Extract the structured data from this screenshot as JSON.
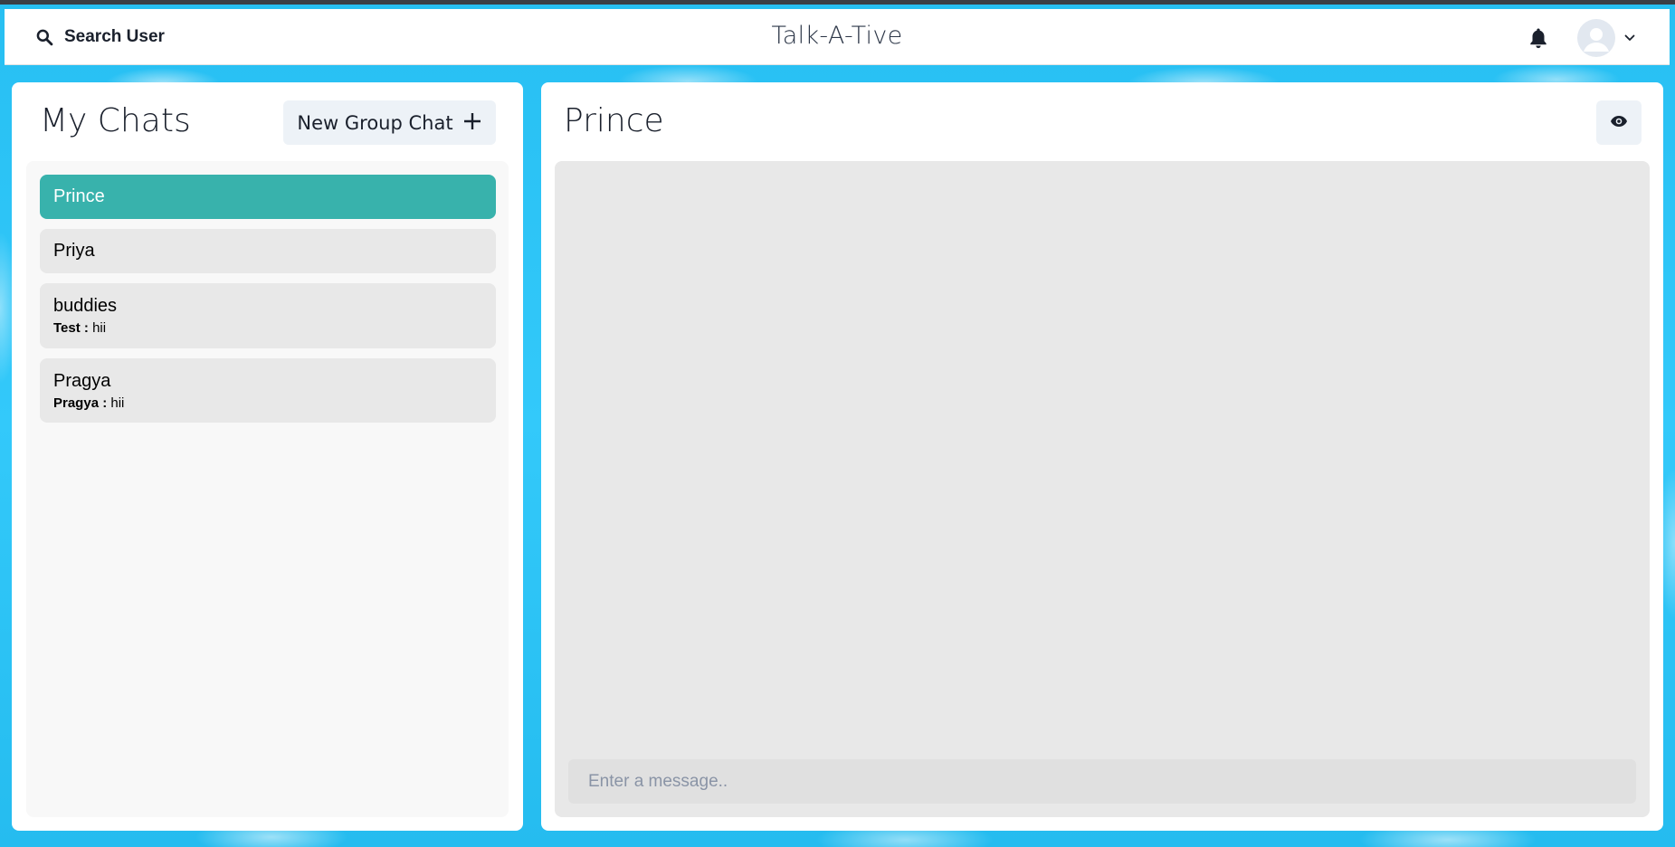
{
  "header": {
    "search_label": "Search User",
    "app_title": "Talk-A-Tive"
  },
  "sidebar": {
    "title": "My Chats",
    "new_group_label": "New Group Chat",
    "chats": [
      {
        "name": "Prince",
        "active": true
      },
      {
        "name": "Priya"
      },
      {
        "name": "buddies",
        "sender": "Test : ",
        "message": "hii"
      },
      {
        "name": "Pragya",
        "sender": "Pragya : ",
        "message": "hii"
      }
    ]
  },
  "chat": {
    "title": "Prince",
    "input_placeholder": "Enter a message.."
  },
  "colors": {
    "accent": "#38b2ac",
    "background": "#2fc6f7"
  }
}
